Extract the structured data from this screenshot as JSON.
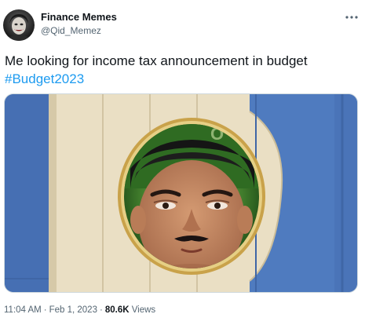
{
  "tweet": {
    "author": {
      "display_name": "Finance Memes",
      "handle": "@Qid_Memez"
    },
    "text": "Me looking for income tax announcement in budget",
    "hashtag": "#Budget2023",
    "media_icon": "meme-image",
    "meta": {
      "time": "11:04 AM",
      "separator": "·",
      "date": "Feb 1, 2023",
      "views_count": "80.6K",
      "views_label": "Views"
    }
  },
  "icons": {
    "more": "more-horizontal-icon"
  },
  "colors": {
    "text": "#0f1419",
    "secondary": "#536471",
    "link": "#1d9bf0",
    "border": "#cfd9de"
  }
}
